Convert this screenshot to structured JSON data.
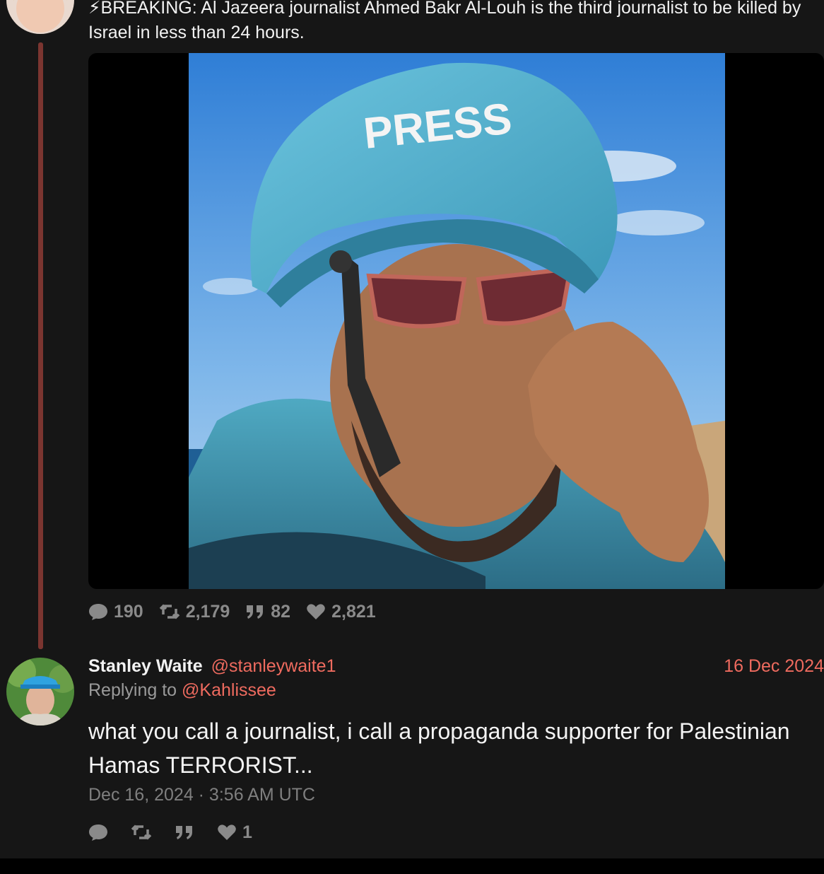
{
  "original_tweet": {
    "text": "⚡BREAKING: Al Jazeera journalist Ahmed Bakr Al-Louh is the third journalist to be killed by Israel in less than 24 hours.",
    "helmet_text": "PRESS",
    "stats": {
      "replies": "190",
      "retweets": "2,179",
      "quotes": "82",
      "likes": "2,821"
    }
  },
  "reply": {
    "display_name": "Stanley Waite",
    "handle": "@stanleywaite1",
    "date": "16 Dec 2024",
    "replying_to_label": "Replying to",
    "replying_to_handle": "@Kahlissee",
    "text": "what you call a journalist, i call a propaganda supporter for Palestinian Hamas TERRORIST...",
    "timestamp": "Dec 16, 2024 · 3:56 AM UTC",
    "stats": {
      "replies": "",
      "retweets": "",
      "quotes": "",
      "likes": "1"
    }
  },
  "colors": {
    "background": "#161616",
    "accent": "#ef6b5f",
    "thread_line": "#7b3530",
    "muted": "#8a8a8a"
  },
  "icons": [
    "comment-icon",
    "retweet-icon",
    "quote-icon",
    "heart-icon"
  ]
}
